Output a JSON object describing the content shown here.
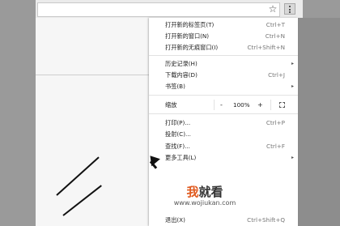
{
  "toolbar": {
    "star_icon": "star-icon",
    "star_glyph": "☆",
    "menu_icon": "kebab-menu-icon"
  },
  "menu": {
    "items": [
      {
        "label": "打开新的标签页(T)",
        "shortcut": "Ctrl+T"
      },
      {
        "label": "打开新的窗口(N)",
        "shortcut": "Ctrl+N"
      },
      {
        "label": "打开新的无痕窗口(I)",
        "shortcut": "Ctrl+Shift+N"
      },
      {
        "label": "历史记录(H)",
        "submenu": "▸"
      },
      {
        "label": "下载内容(D)",
        "shortcut": "Ctrl+J"
      },
      {
        "label": "书签(B)",
        "submenu": "▸"
      },
      {
        "label": "缩放",
        "zoom_minus": "-",
        "zoom_value": "100%",
        "zoom_plus": "+"
      },
      {
        "label": "打印(P)...",
        "shortcut": "Ctrl+P"
      },
      {
        "label": "投射(C)..."
      },
      {
        "label": "查找(F)...",
        "shortcut": "Ctrl+F"
      },
      {
        "label": "更多工具(L)",
        "submenu": "▸"
      },
      {
        "label": "退出(X)",
        "shortcut": "Ctrl+Shift+Q"
      }
    ]
  },
  "watermark": {
    "cn_a": "我",
    "cn_b": "就看",
    "url": "www.wojiukan.com"
  },
  "colors": {
    "watermark_accent": "#e05a1f",
    "menu_bg": "#ffffff",
    "backdrop": "#9a9a9a"
  }
}
